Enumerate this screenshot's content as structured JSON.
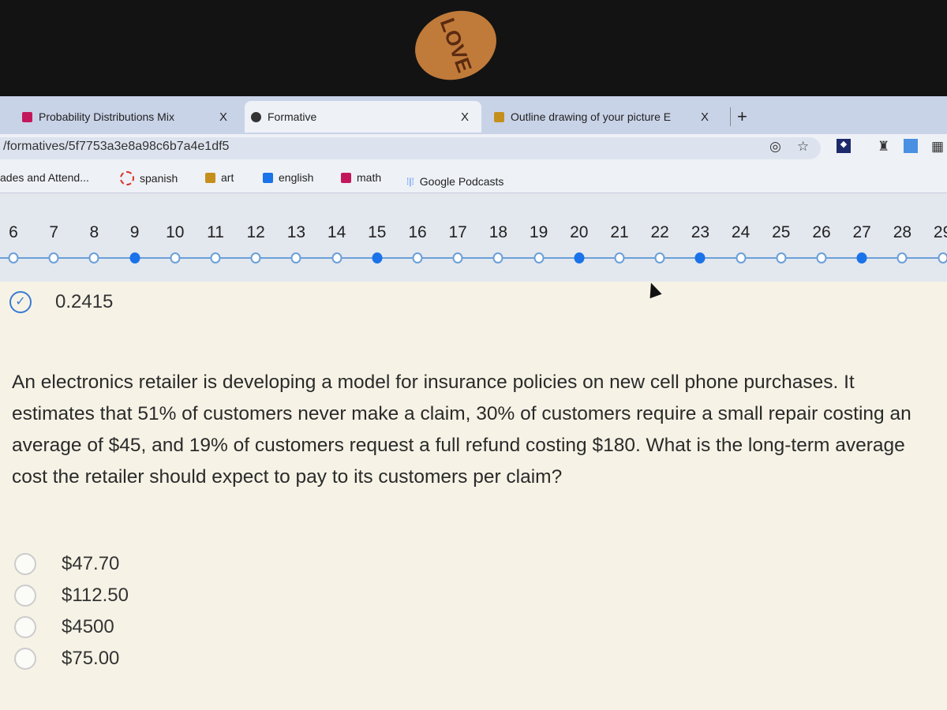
{
  "sticker": "LOVE",
  "tabs": [
    {
      "title": "Probability Distributions Mix",
      "icon": "classroom-icon",
      "close": "X"
    },
    {
      "title": "Formative",
      "icon": "formative-icon",
      "close": "X",
      "active": true
    },
    {
      "title": "Outline drawing of your picture E",
      "icon": "classroom-icon",
      "close": "X"
    }
  ],
  "new_tab": "+",
  "address": "/formatives/5f7753a3e8a98c6b7a4e1df5",
  "bookmarks": [
    {
      "label": "ades and Attend...",
      "icon": ""
    },
    {
      "label": "spanish",
      "icon": "ring-icon",
      "color": "#d93025"
    },
    {
      "label": "art",
      "icon": "classroom-icon",
      "color": "#c58f1d"
    },
    {
      "label": "english",
      "icon": "classroom-icon",
      "color": "#1a73e8"
    },
    {
      "label": "math",
      "icon": "classroom-icon",
      "color": "#c2185b"
    },
    {
      "label": "Google Podcasts",
      "icon": "podcasts-icon",
      "color": "#4285f4"
    }
  ],
  "question_nav": {
    "numbers": [
      "6",
      "7",
      "8",
      "9",
      "10",
      "11",
      "12",
      "13",
      "14",
      "15",
      "16",
      "17",
      "18",
      "19",
      "20",
      "21",
      "22",
      "23",
      "24",
      "25",
      "26",
      "27",
      "28",
      "29"
    ],
    "answered": [
      "9",
      "15",
      "20",
      "23",
      "27"
    ]
  },
  "previous_answer": "0.2415",
  "question": "An electronics retailer is developing a model for insurance policies on new cell phone purchases. It estimates that 51% of customers never make a claim, 30% of customers require a small repair costing an average of $45, and 19% of customers request a full refund costing $180. What is the long-term average cost the retailer should expect to pay to its customers per claim?",
  "options": [
    "$47.70",
    "$112.50",
    "$4500",
    "$75.00"
  ],
  "colors": {
    "accent": "#1a73e8",
    "tabbar": "#c9d3e8"
  }
}
